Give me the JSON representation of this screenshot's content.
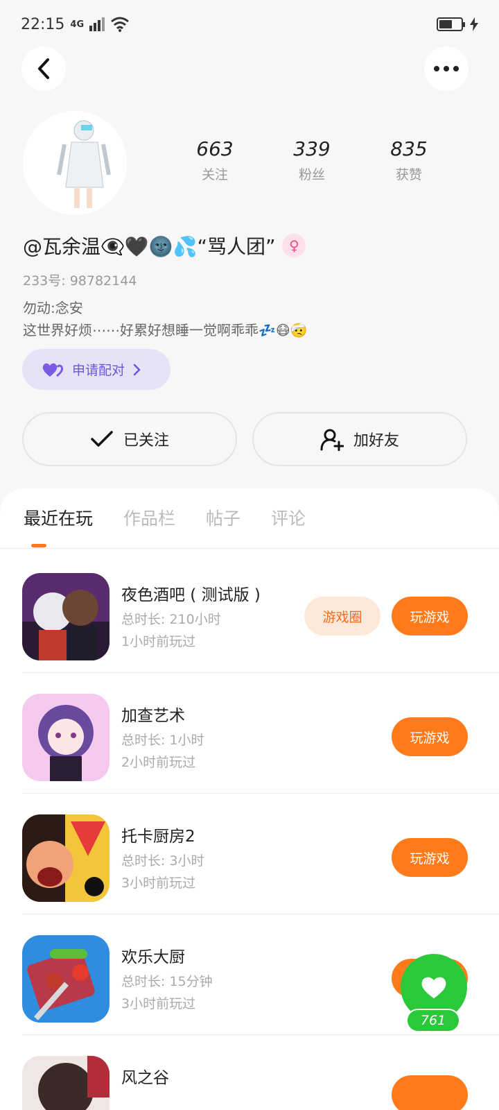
{
  "status_bar": {
    "time": "22:15",
    "network": "4G"
  },
  "profile": {
    "stats": [
      {
        "value": "663",
        "label": "关注"
      },
      {
        "value": "339",
        "label": "粉丝"
      },
      {
        "value": "835",
        "label": "获赞"
      }
    ],
    "username": "@瓦余温👁‍🗨🖤🌚💦“骂人团”",
    "gender_symbol": "♀",
    "user_id": "233号: 98782144",
    "bio_line1": "勿动:念安",
    "bio_line2": "这世界好烦⋯⋯好累好想睡一觉啊乖乖💤😷🤕",
    "pair_label": "申请配对",
    "follow_label": "已关注",
    "add_friend_label": "加好友"
  },
  "tabs": [
    {
      "label": "最近在玩"
    },
    {
      "label": "作品栏"
    },
    {
      "label": "帖子"
    },
    {
      "label": "评论"
    }
  ],
  "games": [
    {
      "name": "夜色酒吧 ( 测试版 )",
      "total": "总时长: 210小时",
      "last": "1小时前玩过",
      "circle": "游戏圈",
      "play": "玩游戏"
    },
    {
      "name": "加查艺术",
      "total": "总时长: 1小时",
      "last": "2小时前玩过",
      "play": "玩游戏"
    },
    {
      "name": "托卡厨房2",
      "total": "总时长: 3小时",
      "last": "3小时前玩过",
      "play": "玩游戏"
    },
    {
      "name": "欢乐大厨",
      "total": "总时长: 15分钟",
      "last": "3小时前玩过",
      "play": "玩游戏"
    },
    {
      "name": "风之谷"
    }
  ],
  "like": {
    "count": "761"
  },
  "colors": {
    "accent": "#ff7a1a",
    "like": "#2bc93a",
    "pair": "#6d57d8"
  }
}
